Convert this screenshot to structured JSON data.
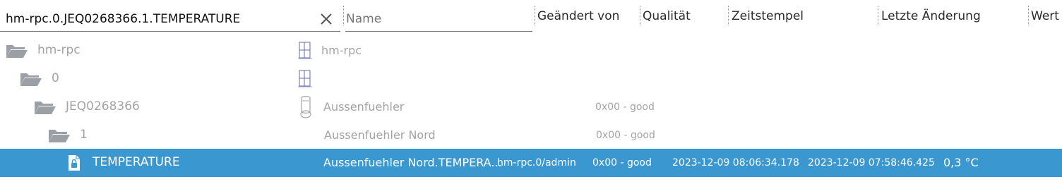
{
  "filter": {
    "id_value": "hm-rpc.0.JEQ0268366.1.TEMPERATURE",
    "name_placeholder": "Name"
  },
  "columns": {
    "changed_by": "Geändert von",
    "quality": "Qualität",
    "timestamp": "Zeitstempel",
    "last_change": "Letzte Änderung",
    "value": "Wert"
  },
  "rows": [
    {
      "id": "hm-rpc",
      "icon": "folder-open-icon",
      "role_icon": "instance-icon",
      "name": "hm-rpc",
      "quality": "",
      "ts": "",
      "lc": "",
      "value": "",
      "changed_by": ""
    },
    {
      "id": "0",
      "icon": "folder-open-icon",
      "role_icon": "instance-icon",
      "name": "",
      "quality": "",
      "ts": "",
      "lc": "",
      "value": "",
      "changed_by": ""
    },
    {
      "id": "JEQ0268366",
      "icon": "folder-open-icon",
      "role_icon": "device-icon",
      "name": "Aussenfuehler",
      "quality": "0x00 - good",
      "ts": "",
      "lc": "",
      "value": "",
      "changed_by": ""
    },
    {
      "id": "1",
      "icon": "folder-open-icon",
      "role_icon": "",
      "name": "Aussenfuehler Nord",
      "quality": "0x00 - good",
      "ts": "",
      "lc": "",
      "value": "",
      "changed_by": ""
    },
    {
      "id": "TEMPERATURE",
      "icon": "state-file-icon",
      "role_icon": "",
      "name": "Aussenfuehler Nord.TEMPERA...",
      "changed_by": "hm-rpc.0/admin",
      "quality": "0x00 - good",
      "ts": "2023-12-09 08:06:34.178",
      "lc": "2023-12-09 07:58:46.425",
      "value": "0,3 °C"
    }
  ],
  "colors": {
    "selection": "#3a97cf",
    "folder": "#9aa0a6",
    "grey_text": "#a3a3a3"
  }
}
